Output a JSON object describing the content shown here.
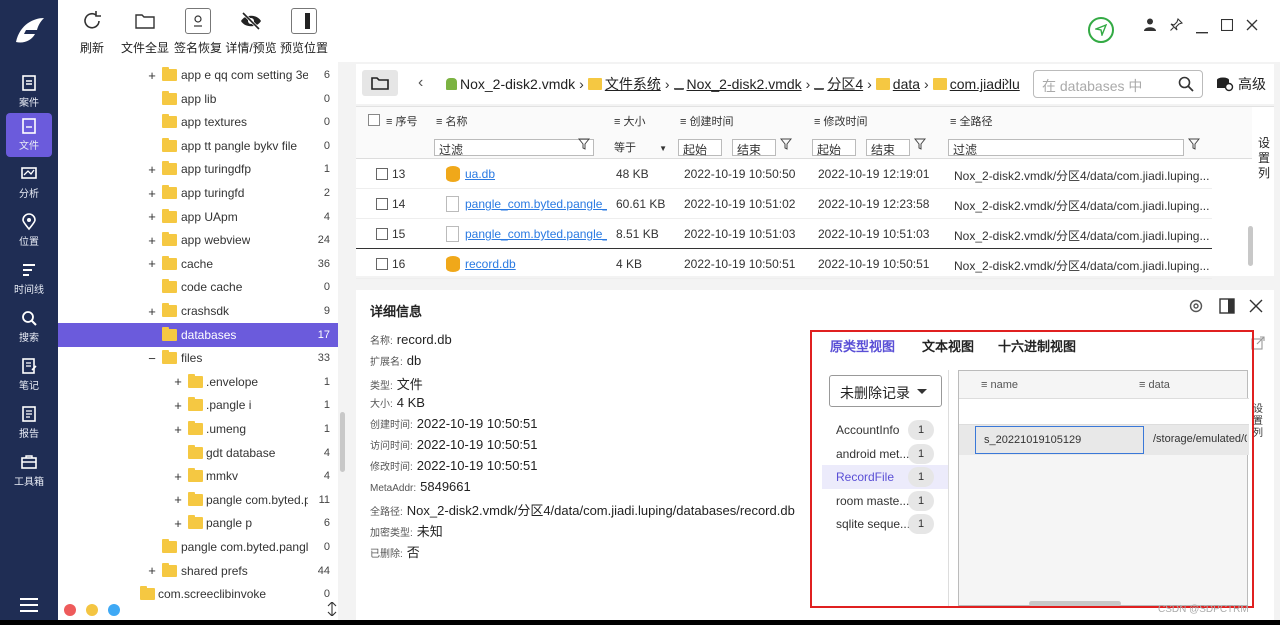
{
  "colors": {
    "nav_bg": "#1f2d54",
    "accent": "#6b5bdc",
    "folder": "#f5c842",
    "link": "#2a7ae2",
    "highlight_box": "#e02020"
  },
  "nav": {
    "items": [
      {
        "label": "案件",
        "icon": "case-icon"
      },
      {
        "label": "文件",
        "icon": "file-icon"
      },
      {
        "label": "分析",
        "icon": "analysis-icon"
      },
      {
        "label": "位置",
        "icon": "location-icon"
      },
      {
        "label": "时间线",
        "icon": "timeline-icon"
      },
      {
        "label": "搜索",
        "icon": "search-icon"
      },
      {
        "label": "笔记",
        "icon": "note-icon"
      },
      {
        "label": "报告",
        "icon": "report-icon"
      },
      {
        "label": "工具箱",
        "icon": "toolbox-icon"
      }
    ]
  },
  "toolbar": {
    "refresh": "刷新",
    "file_overview": "文件全显",
    "sig_recover": "签名恢复",
    "detail_preview": "详情/预览",
    "preview_pos": "预览位置"
  },
  "tree": {
    "rows": [
      {
        "label": "app e qq com setting 3e...",
        "count": "6",
        "expander": "+"
      },
      {
        "label": "app lib",
        "count": "0",
        "expander": ""
      },
      {
        "label": "app textures",
        "count": "0",
        "expander": ""
      },
      {
        "label": "app tt pangle bykv file",
        "count": "0",
        "expander": ""
      },
      {
        "label": "app turingdfp",
        "count": "1",
        "expander": "+"
      },
      {
        "label": "app turingfd",
        "count": "2",
        "expander": "+"
      },
      {
        "label": "app UApm",
        "count": "4",
        "expander": "+"
      },
      {
        "label": "app webview",
        "count": "24",
        "expander": "+"
      },
      {
        "label": "cache",
        "count": "36",
        "expander": "+"
      },
      {
        "label": "code cache",
        "count": "0",
        "expander": ""
      },
      {
        "label": "crashsdk",
        "count": "9",
        "expander": "+"
      },
      {
        "label": "databases",
        "count": "17",
        "expander": ""
      },
      {
        "label": "files",
        "count": "33",
        "expander": "−"
      },
      {
        "label": ".envelope",
        "count": "1",
        "expander": "+"
      },
      {
        "label": ".pangle i",
        "count": "1",
        "expander": "+"
      },
      {
        "label": ".umeng",
        "count": "1",
        "expander": "+"
      },
      {
        "label": "gdt database",
        "count": "4",
        "expander": ""
      },
      {
        "label": "mmkv",
        "count": "4",
        "expander": "+"
      },
      {
        "label": "pangle com.byted.p...",
        "count": "11",
        "expander": "+"
      },
      {
        "label": "pangle p",
        "count": "6",
        "expander": "+"
      },
      {
        "label": "pangle com.byted.pangle",
        "count": "0",
        "expander": ""
      },
      {
        "label": "shared prefs",
        "count": "44",
        "expander": "+"
      },
      {
        "label": "com.screeclibinvoke",
        "count": "0",
        "expander": ""
      }
    ]
  },
  "pathbar": {
    "crumbs": [
      "Nox_2-disk2.vmdk",
      "文件系统",
      "Nox_2-disk2.vmdk",
      "分区4",
      "data",
      "com.jiadi.lu"
    ],
    "search_placeholder": "在 databases 中",
    "advanced": "高级"
  },
  "file_table": {
    "headers": {
      "index": "序号",
      "name": "名称",
      "size": "大小",
      "created": "创建时间",
      "modified": "修改时间",
      "fullpath": "全路径"
    },
    "filters": {
      "name": "过滤",
      "size_op": "等于",
      "start": "起始",
      "end": "结束",
      "path": "过滤"
    },
    "rows": [
      {
        "index": "13",
        "name": "ua.db",
        "size": "48 KB",
        "created": "2022-10-19 10:50:50",
        "modified": "2022-10-19 12:19:01",
        "path": "Nox_2-disk2.vmdk/分区4/data/com.jiadi.luping...",
        "type": "db"
      },
      {
        "index": "14",
        "name": "pangle_com.byted.pangle_t",
        "size": "60.61 KB",
        "created": "2022-10-19 10:51:02",
        "modified": "2022-10-19 12:23:58",
        "path": "Nox_2-disk2.vmdk/分区4/data/com.jiadi.luping...",
        "type": "file"
      },
      {
        "index": "15",
        "name": "pangle_com.byted.pangle_r",
        "size": "8.51 KB",
        "created": "2022-10-19 10:51:03",
        "modified": "2022-10-19 10:51:03",
        "path": "Nox_2-disk2.vmdk/分区4/data/com.jiadi.luping...",
        "type": "file"
      },
      {
        "index": "16",
        "name": "record.db",
        "size": "4 KB",
        "created": "2022-10-19 10:50:51",
        "modified": "2022-10-19 10:50:51",
        "path": "Nox_2-disk2.vmdk/分区4/data/com.jiadi.luping...",
        "type": "db"
      }
    ],
    "side_label": "设置列"
  },
  "detail": {
    "title": "详细信息",
    "props": [
      {
        "k": "名称:",
        "v": "record.db"
      },
      {
        "k": "扩展名:",
        "v": "db"
      },
      {
        "k": "类型:",
        "v": "文件"
      },
      {
        "k": "大小:",
        "v": "4 KB"
      },
      {
        "k": "创建时间:",
        "v": "2022-10-19 10:50:51"
      },
      {
        "k": "访问时间:",
        "v": "2022-10-19 10:50:51"
      },
      {
        "k": "修改时间:",
        "v": "2022-10-19 10:50:51"
      },
      {
        "k": "MetaAddr:",
        "v": "5849661"
      },
      {
        "k": "全路径:",
        "v": "Nox_2-disk2.vmdk/分区4/data/com.jiadi.luping/databases/record.db"
      },
      {
        "k": "加密类型:",
        "v": "未知"
      },
      {
        "k": "已删除:",
        "v": "否"
      }
    ]
  },
  "viewer": {
    "tabs": [
      "原类型视图",
      "文本视图",
      "十六进制视图"
    ],
    "dropdown": "未删除记录",
    "tables": [
      {
        "name": "AccountInfo",
        "count": "1"
      },
      {
        "name": "android met...",
        "count": "1"
      },
      {
        "name": "RecordFile",
        "count": "1"
      },
      {
        "name": "room maste...",
        "count": "1"
      },
      {
        "name": "sqlite seque...",
        "count": "1"
      }
    ],
    "grid": {
      "columns": [
        "name",
        "data"
      ],
      "row": {
        "name": "s_20221019105129",
        "data": "/storage/emulated/0/"
      }
    },
    "side_label": "设置列"
  },
  "watermark": "CSDN @SDPCTRM"
}
